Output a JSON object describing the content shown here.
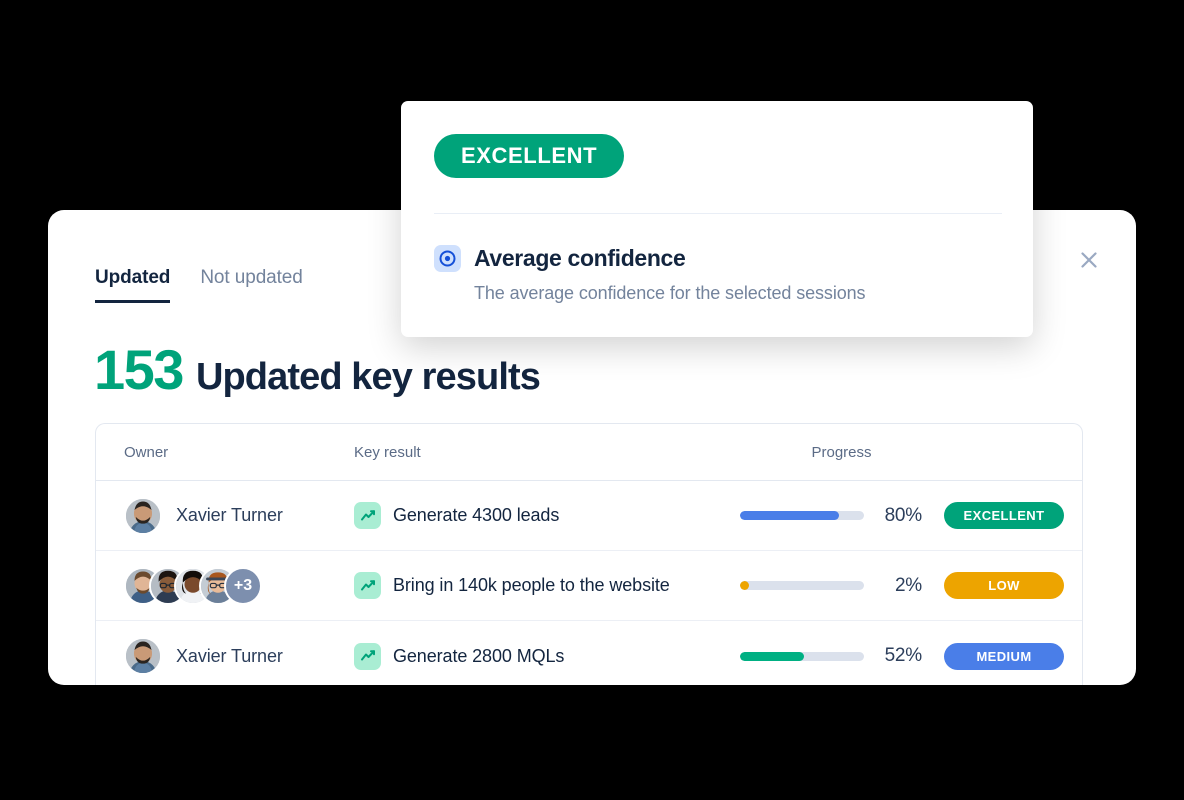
{
  "tooltip": {
    "rating_badge": "EXCELLENT",
    "rating_color": "#00a37a",
    "icon": "target-circle-icon",
    "title": "Average confidence",
    "subtitle": "The average confidence for the selected sessions"
  },
  "panel": {
    "tabs": [
      {
        "label": "Updated",
        "active": true
      },
      {
        "label": "Not updated",
        "active": false
      }
    ],
    "close_icon": "close-icon",
    "headline": {
      "count": "153",
      "count_color": "#00a37a",
      "caption": "Updated key results"
    },
    "table": {
      "columns": [
        "Owner",
        "Key result",
        "Progress"
      ],
      "rows": [
        {
          "owner": "Xavier Turner",
          "owner_type": "single",
          "extra_count": "",
          "key_result": "Generate 4300 leads",
          "key_result_icon": "trend-line-icon",
          "progress_value": 80,
          "progress_label": "80%",
          "progress_color": "#4a7ee8",
          "badge_label": "EXCELLENT",
          "badge_color": "#00a37a"
        },
        {
          "owner": "",
          "owner_type": "stack",
          "extra_count": "+3",
          "key_result": "Bring in 140k people to the website",
          "key_result_icon": "trend-line-icon",
          "progress_value": 2,
          "progress_label": "2%",
          "progress_color": "#eda400",
          "badge_label": "LOW",
          "badge_color": "#eda400"
        },
        {
          "owner": "Xavier Turner",
          "owner_type": "single",
          "extra_count": "",
          "key_result": "Generate 2800 MQLs",
          "key_result_icon": "trend-line-icon",
          "progress_value": 52,
          "progress_label": "52%",
          "progress_color": "#00b083",
          "badge_label": "MEDIUM",
          "badge_color": "#4a7ee8"
        }
      ]
    }
  }
}
